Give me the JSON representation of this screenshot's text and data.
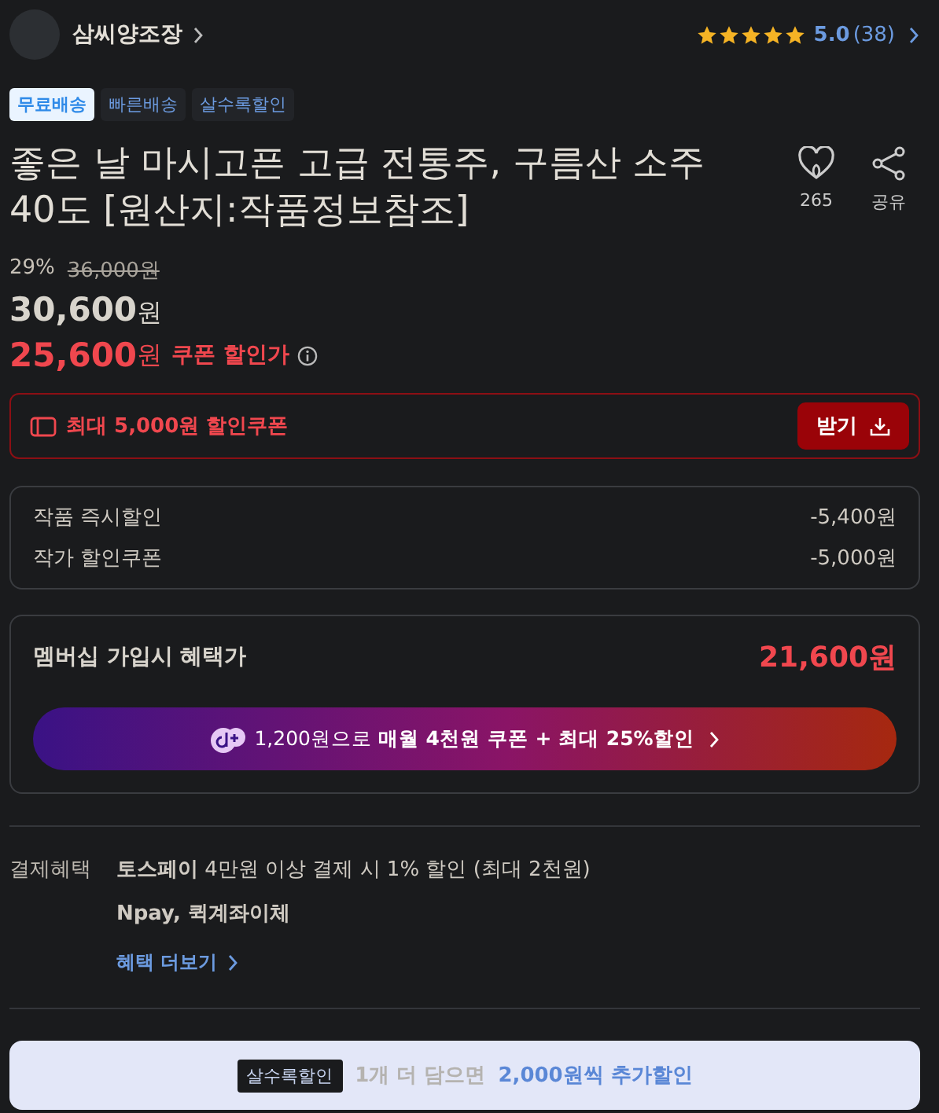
{
  "shop": {
    "name": "삼씨양조장",
    "stars": 5,
    "rating": "5.0",
    "review_count": "(38)"
  },
  "tags": [
    {
      "label": "무료배송",
      "highlighted": true
    },
    {
      "label": "빠른배송",
      "highlighted": false
    },
    {
      "label": "살수록할인",
      "highlighted": false
    }
  ],
  "product": {
    "title": "좋은 날 마시고픈 고급 전통주, 구름산 소주 40도 [원산지:작품정보참조]",
    "like_count": "265",
    "share_label": "공유"
  },
  "price": {
    "discount_rate": "29%",
    "original": "36,000원",
    "sale_amount": "30,600",
    "sale_unit": "원",
    "coupon_amount": "25,600",
    "coupon_unit": "원",
    "coupon_label": "쿠폰 할인가"
  },
  "coupon": {
    "text": "최대 5,000원 할인쿠폰",
    "button": "받기"
  },
  "discounts": [
    {
      "label": "작품 즉시할인",
      "amount": "-5,400원"
    },
    {
      "label": "작가 할인쿠폰",
      "amount": "-5,000원"
    }
  ],
  "membership": {
    "label": "멤버십 가입시 혜택가",
    "price": "21,600원",
    "promo": "1,200원으로 **매월 4천원 쿠폰 + 최대 25%할인**"
  },
  "payment": {
    "label": "결제혜택",
    "lines": [
      "**토스페이** 4만원 이상 결제 시 1% 할인 (최대 2천원)",
      "Npay, 퀵계좌이체"
    ],
    "more": "혜택 더보기"
  },
  "bundle": {
    "badge": "살수록할인",
    "text": "1개 더 담으면",
    "highlight": "2,000원씩 추가할인"
  }
}
